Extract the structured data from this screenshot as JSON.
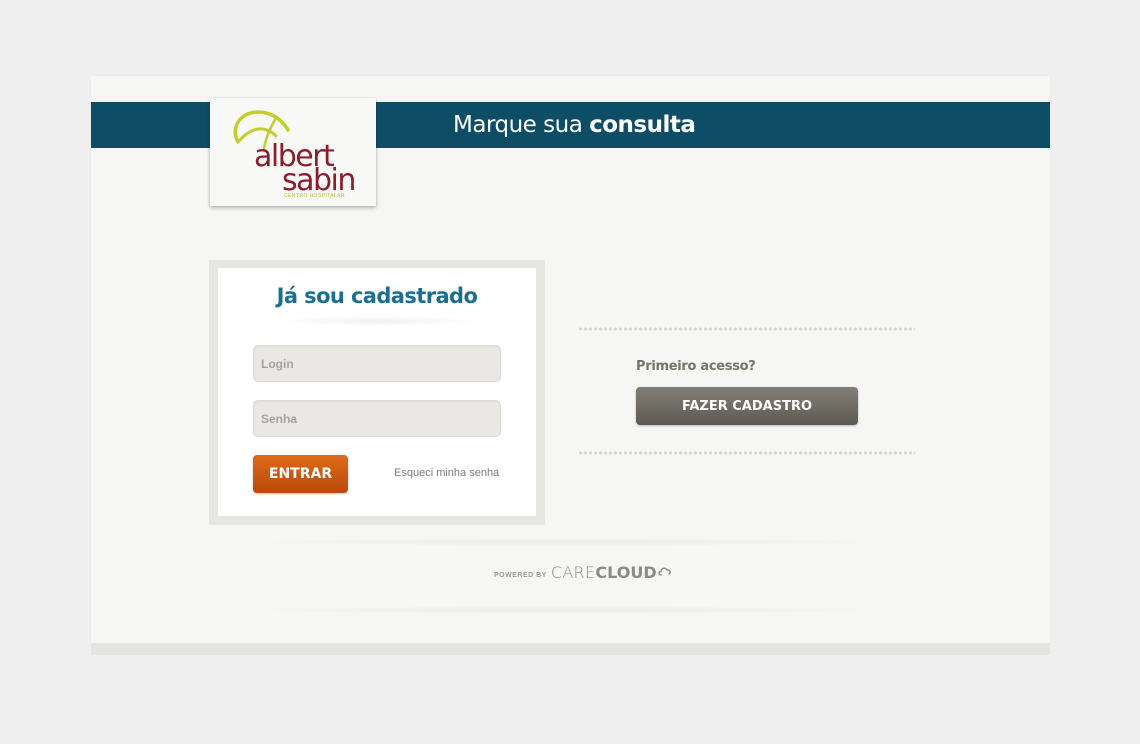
{
  "header": {
    "title_regular": "Marque sua",
    "title_bold": "consulta"
  },
  "logo": {
    "line1": "albert",
    "line2": "sabin",
    "tagline": "CENTRO HOSPITALAR",
    "icon": "albert-sabin-logo-icon"
  },
  "login": {
    "title": "Já sou cadastrado",
    "login_placeholder": "Login",
    "password_placeholder": "Senha",
    "submit_label": "ENTRAR",
    "forgot_label": "Esqueci minha senha"
  },
  "signup": {
    "prompt": "Primeiro acesso?",
    "button_label": "FAZER CADASTRO"
  },
  "footer": {
    "powered_by": "POWERED BY",
    "brand_part1": "CARE",
    "brand_part2": "CLOUD",
    "icon": "cloud-icon"
  },
  "colors": {
    "banner": "#0e4d66",
    "title_blue": "#1c6f90",
    "primary_button": "#d0601a",
    "secondary_button": "#6f6c64",
    "logo_red": "#8b1e2b",
    "logo_green": "#c2cf2a"
  }
}
